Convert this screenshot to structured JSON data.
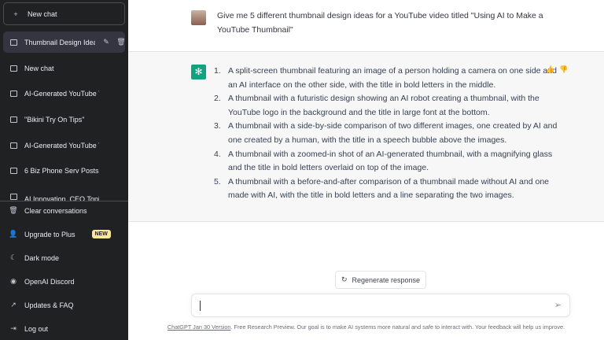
{
  "sidebar": {
    "new_chat": "New chat",
    "active_chat": "Thumbnail Design Ideas",
    "chats": [
      "New chat",
      "AI-Generated YouTube Thum",
      "\"Bikini Try On Tips\"",
      "AI-Generated YouTube Thum",
      "6 Biz Phone Serv Posts",
      "AI Innovation, CEO Topics"
    ],
    "bottom": [
      {
        "label": "Clear conversations",
        "icon": "trash-icon"
      },
      {
        "label": "Upgrade to Plus",
        "icon": "user-icon",
        "badge": "NEW"
      },
      {
        "label": "Dark mode",
        "icon": "moon-icon"
      },
      {
        "label": "OpenAI Discord",
        "icon": "discord-icon"
      },
      {
        "label": "Updates & FAQ",
        "icon": "external-link-icon"
      },
      {
        "label": "Log out",
        "icon": "logout-icon"
      }
    ]
  },
  "conversation": {
    "user_message": "Give me 5 different thumbnail design ideas for a YouTube video titled \"Using AI to Make a YouTube Thumbnail\"",
    "assistant_items": [
      "A split-screen thumbnail featuring an image of a person holding a camera on one side and an AI interface on the other side, with the title in bold letters in the middle.",
      "A thumbnail with a futuristic design showing an AI robot creating a thumbnail, with the YouTube logo in the background and the title in large font at the bottom.",
      "A thumbnail with a side-by-side comparison of two different images, one created by AI and one created by a human, with the title in a speech bubble above the images.",
      "A thumbnail with a zoomed-in shot of an AI-generated thumbnail, with a magnifying glass and the title in bold letters overlaid on top of the image.",
      "A thumbnail with a before-and-after comparison of a thumbnail made without AI and one made with AI, with the title in bold letters and a line separating the two images."
    ],
    "numbers": [
      "1.",
      "2.",
      "3.",
      "4.",
      "5."
    ]
  },
  "regenerate_label": "Regenerate response",
  "input": {
    "value": ""
  },
  "footer": {
    "link": "ChatGPT Jan 30 Version",
    "text": ". Free Research Preview. Our goal is to make AI systems more natural and safe to interact with. Your feedback will help us improve."
  }
}
